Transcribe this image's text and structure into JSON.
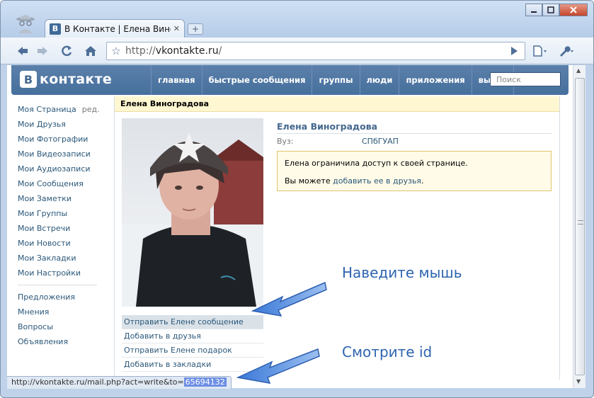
{
  "browser": {
    "tab_title": "В Контакте | Елена Вино...",
    "tab_close": "✕",
    "new_tab": "+",
    "url_scheme": "http://",
    "url_host": "vkontakte.ru",
    "url_path": "/",
    "status_prefix": "http://vkontakte.ru/mail.php?act=write&to=",
    "status_id": "65694132"
  },
  "header": {
    "logo_b": "B",
    "logo_text": "контакте",
    "nav": [
      "главная",
      "быстрые сообщения",
      "группы",
      "люди",
      "приложения",
      "выйти"
    ],
    "search_placeholder": "Поиск"
  },
  "leftmenu": {
    "my_page": "Моя Страница",
    "edit": "ред.",
    "items": [
      "Мои Друзья",
      "Мои Фотографии",
      "Мои Видеозаписи",
      "Мои Аудиозаписи",
      "Мои Сообщения",
      "Мои Заметки",
      "Мои Группы",
      "Мои Встречи",
      "Мои Новости",
      "Мои Закладки",
      "Мои Настройки"
    ],
    "extra": [
      "Предложения",
      "Мнения",
      "Вопросы",
      "Объявления"
    ]
  },
  "profile": {
    "title": "Елена Виноградова",
    "name": "Елена Виноградова",
    "uni_label": "Вуз:",
    "uni_value": "СПбГУАП",
    "notice_line1": "Елена ограничила доступ к своей странице.",
    "notice_prefix": "Вы можете ",
    "notice_link": "добавить ее в друзья",
    "notice_suffix": ".",
    "actions": [
      "Отправить Елене сообщение",
      "Добавить в друзья",
      "Отправить Елене подарок",
      "Добавить в закладки"
    ]
  },
  "annotations": {
    "hover": "Наведите мышь",
    "look": "Смотрите id"
  },
  "colors": {
    "vk_blue": "#45688e",
    "link": "#2b587a",
    "annotation": "#2e64b0"
  }
}
